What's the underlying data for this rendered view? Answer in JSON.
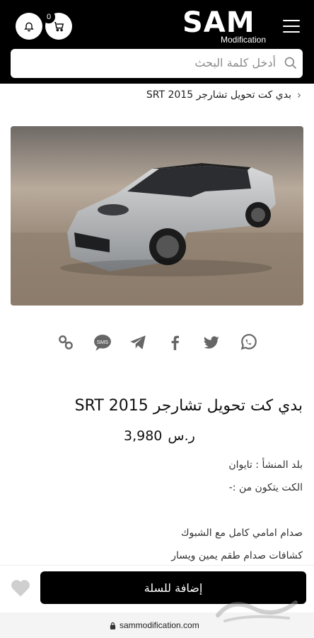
{
  "header": {
    "logo_main": "SAM",
    "logo_sub": "Modification",
    "cart_count": "0",
    "search_placeholder": "أدخل كلمة البحث"
  },
  "breadcrumb": {
    "current": "بدي كت تحويل تشارجر 2015 SRT"
  },
  "share": {
    "icons": [
      "whatsapp-icon",
      "twitter-icon",
      "facebook-icon",
      "telegram-icon",
      "sms-icon",
      "link-icon"
    ],
    "sms_label": "SMS"
  },
  "product": {
    "title": "بدي كت تحويل تشارجر 2015 SRT",
    "price": "3,980",
    "currency": "ر.س",
    "origin": "بلد المنشأ : تايوان",
    "kit_intro": "الكت يتكون من :-",
    "items": [
      "صدام امامي كامل مع الشبوك",
      "كشافات صدام طقم يمين ويسار"
    ]
  },
  "actions": {
    "add_to_cart": "إضافة للسلة"
  },
  "browser": {
    "url": "sammodification.com"
  },
  "colors": {
    "header_bg": "#000000",
    "button_bg": "#000000"
  }
}
